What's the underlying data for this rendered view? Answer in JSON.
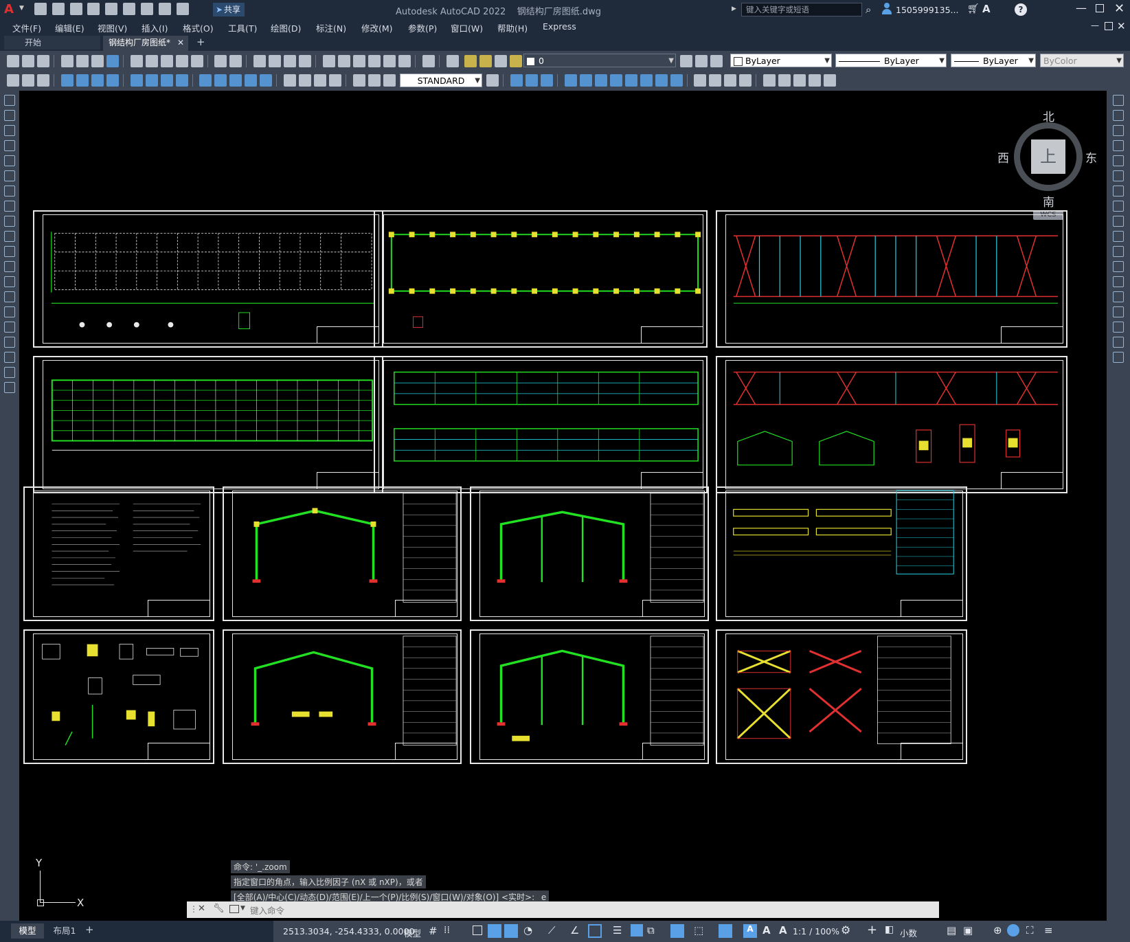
{
  "app": {
    "title": "Autodesk AutoCAD 2022",
    "filename": "钢结构厂房图纸.dwg",
    "logo": "A",
    "share_label": "共享"
  },
  "search": {
    "placeholder": "键入关键字或短语"
  },
  "user": {
    "name": "1505999135..."
  },
  "menu": [
    "文件(F)",
    "编辑(E)",
    "视图(V)",
    "插入(I)",
    "格式(O)",
    "工具(T)",
    "绘图(D)",
    "标注(N)",
    "修改(M)",
    "参数(P)",
    "窗口(W)",
    "帮助(H)",
    "Express"
  ],
  "tabs": [
    {
      "label": "开始"
    },
    {
      "label": "钢结构厂房图纸*"
    }
  ],
  "toolbar": {
    "layer": "0",
    "text_style": "STANDARD",
    "color": "ByLayer",
    "linetype": "ByLayer",
    "lineweight": "ByLayer",
    "plotstyle": "ByColor"
  },
  "viewcube": {
    "north": "北",
    "south": "南",
    "east": "东",
    "west": "西",
    "top": "上",
    "wcs": "WCS"
  },
  "ucs": {
    "x": "X",
    "y": "Y"
  },
  "command": {
    "history": [
      "命令: '_.zoom",
      "指定窗口的角点，输入比例因子 (nX 或 nXP)，或者",
      "[全部(A)/中心(C)/动态(D)/范围(E)/上一个(P)/比例(S)/窗口(W)/对象(O)] <实时>: _e"
    ],
    "placeholder": "键入命令"
  },
  "layout_tabs": [
    "模型",
    "布局1"
  ],
  "status": {
    "coords": "2513.3034, -254.4333, 0.0000",
    "model": "模型",
    "scale": "1:1 / 100%",
    "units": "小数"
  },
  "colors": {
    "chrome_dark": "#1f2a3a",
    "toolbar": "#3b4453",
    "canvas": "#000000",
    "green": "#22e022",
    "red": "#e23030",
    "cyan": "#23d6e6",
    "yellow": "#e8e030",
    "white": "#e8e8e8"
  }
}
